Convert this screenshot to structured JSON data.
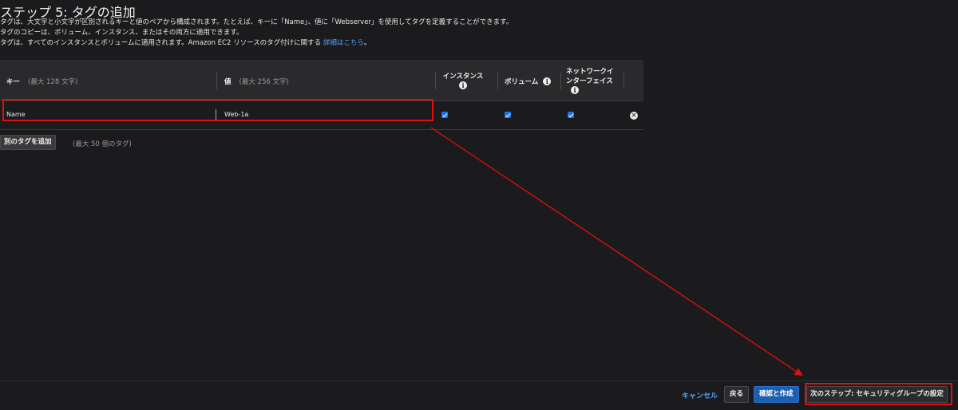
{
  "page": {
    "title": "ステップ 5: タグの追加",
    "desc_line1": "タグは、大文字と小文字が区別されるキーと値のペアから構成されます。たとえば、キーに「Name」、値に「Webserver」を使用してタグを定義することができます。",
    "desc_line2": "タグのコピーは、ボリューム、インスタンス、またはその両方に適用できます。",
    "desc_line3": "タグは、すべてのインスタンスとボリュームに適用されます。Amazon EC2 リソースのタグ付けに関する",
    "desc_link": "詳細はこちら",
    "desc_link_suffix": "。"
  },
  "table": {
    "headers": {
      "key": "キー",
      "key_hint": "(最大 128 文字)",
      "value": "値",
      "value_hint": "(最大 256 文字)",
      "instances": "インスタンス",
      "volumes": "ボリューム",
      "network_line1": "ネットワークイ",
      "network_line2": "ンターフェイス"
    },
    "rows": [
      {
        "key": "Name",
        "value": "Web-1a",
        "instances": true,
        "volumes": true,
        "network": true
      }
    ],
    "add_tag_label": "別のタグを追加",
    "add_tag_hint": "(最大 50 個のタグ)"
  },
  "icons": {
    "info": "info-icon",
    "remove": "remove-icon",
    "check": "checkbox-checked-icon"
  },
  "footer": {
    "cancel": "キャンセル",
    "back": "戻る",
    "review": "確認と作成",
    "next": "次のステップ: セキュリティグループの設定"
  },
  "colors": {
    "accent": "#1f5fb0",
    "link": "#4fa3ff",
    "annotation": "#e01010",
    "background": "#1b1b1d"
  }
}
